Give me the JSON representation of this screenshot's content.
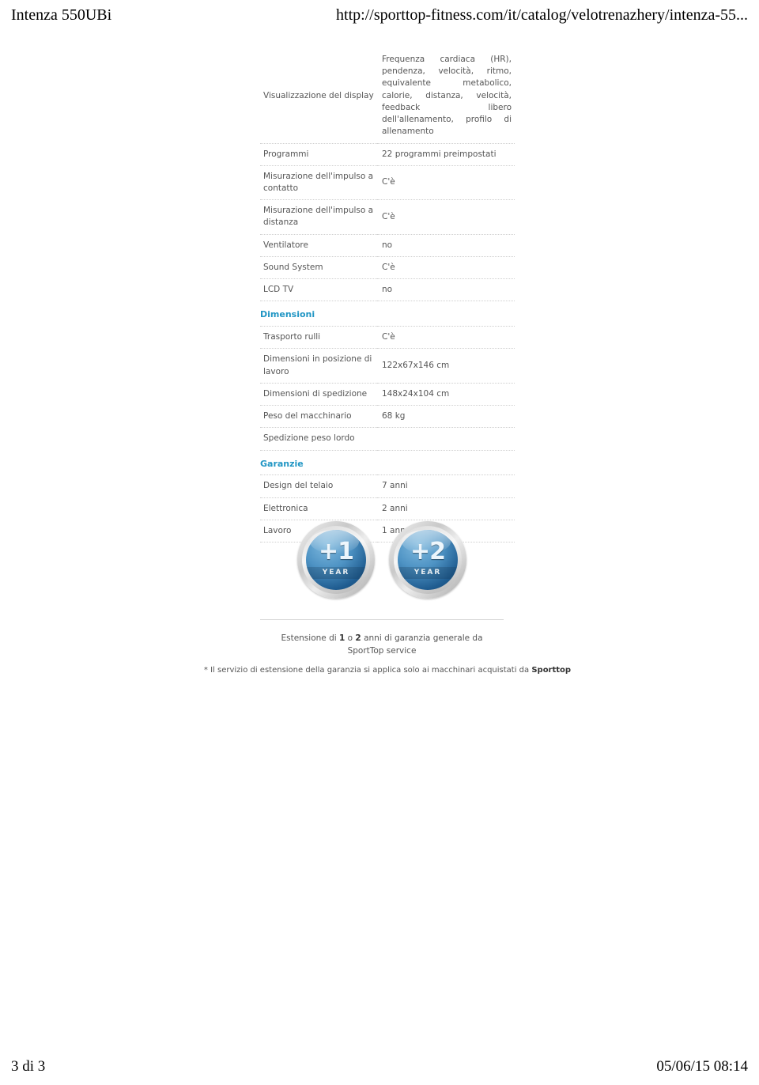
{
  "print_header": {
    "left": "Intenza 550UBi",
    "right": "http://sporttop-fitness.com/it/catalog/velotrenazhery/intenza-55..."
  },
  "print_footer": {
    "left": "3 di 3",
    "right": "05/06/15 08:14"
  },
  "spec_table": {
    "rows": [
      {
        "type": "row",
        "label": "Visualizzazione del display",
        "value": "Frequenza cardiaca (HR), pendenza, velocità, ritmo, equivalente metabolico, calorie, distanza, velocità, feedback libero dell'allenamento, profilo di allenamento",
        "justified": true
      },
      {
        "type": "row",
        "label": "Programmi",
        "value": "22 programmi preimpostati"
      },
      {
        "type": "row",
        "label": "Misurazione dell'impulso a contatto",
        "value": "C'è"
      },
      {
        "type": "row",
        "label": "Misurazione dell'impulso a distanza",
        "value": "C'è"
      },
      {
        "type": "row",
        "label": "Ventilatore",
        "value": "no"
      },
      {
        "type": "row",
        "label": "Sound System",
        "value": "C'è"
      },
      {
        "type": "row",
        "label": "LCD TV",
        "value": "no"
      },
      {
        "type": "section",
        "label": "Dimensioni"
      },
      {
        "type": "row",
        "label": "Trasporto rulli",
        "value": "C'è"
      },
      {
        "type": "row",
        "label": "Dimensioni in posizione di lavoro",
        "value": "122x67x146 cm"
      },
      {
        "type": "row",
        "label": "Dimensioni di spedizione",
        "value": "148x24x104 cm"
      },
      {
        "type": "row",
        "label": "Peso del macchinario",
        "value": "68 kg"
      },
      {
        "type": "row",
        "label": "Spedizione peso lordo",
        "value": ""
      },
      {
        "type": "section",
        "label": "Garanzie"
      },
      {
        "type": "row",
        "label": "Design del telaio",
        "value": "7 anni"
      },
      {
        "type": "row",
        "label": "Elettronica",
        "value": "2 anni"
      },
      {
        "type": "row",
        "label": "Lavoro",
        "value": "1 anno"
      }
    ]
  },
  "badges": [
    {
      "num": "+1",
      "unit": "YEAR"
    },
    {
      "num": "+2",
      "unit": "YEAR"
    }
  ],
  "warranty": {
    "line1_a": "Estensione di ",
    "line1_b": "1",
    "line1_c": " o ",
    "line1_d": "2",
    "line1_e": " anni di garanzia generale da",
    "line2": "SportTop service",
    "footnote_a": "* Il servizio di estensione della garanzia si applica solo ai macchinari acquistati da ",
    "footnote_b": "Sporttop"
  },
  "colors": {
    "section_heading": "#2196c4",
    "body_text": "#555555",
    "divider": "#cfcfcf"
  }
}
